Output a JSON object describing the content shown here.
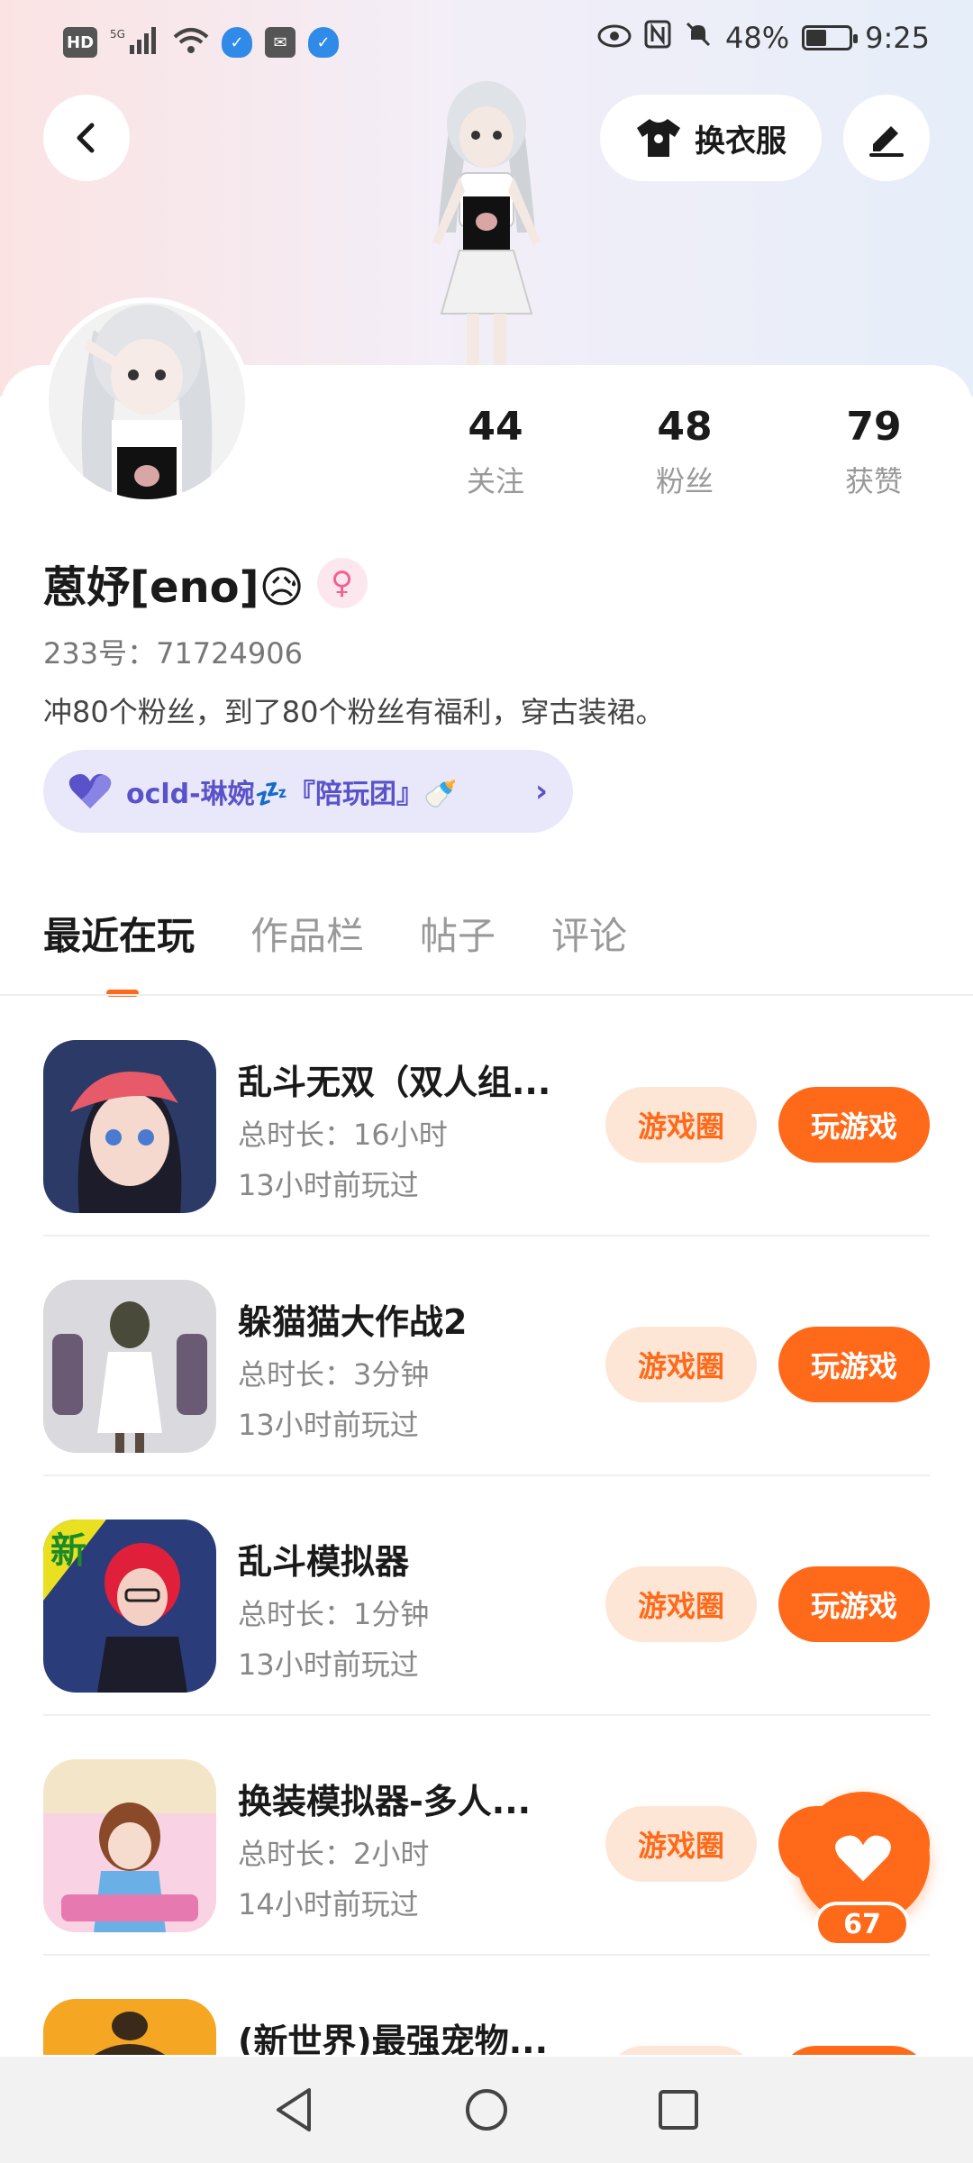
{
  "status_bar": {
    "left_icons": [
      "HD",
      "5G",
      "signal-icon",
      "wifi-icon",
      "shield-icon",
      "mail-icon",
      "shield-icon"
    ],
    "battery_percent": "48%",
    "battery_level": 0.48,
    "time": "9:25"
  },
  "header": {
    "wardrobe_label": "换衣服"
  },
  "profile": {
    "stats": [
      {
        "value": "44",
        "label": "关注"
      },
      {
        "value": "48",
        "label": "粉丝"
      },
      {
        "value": "79",
        "label": "获赞"
      }
    ],
    "name": "蒽妤[eno]😥",
    "gender_symbol": "♀",
    "uid": "233号：71724906",
    "bio": "冲80个粉丝，到了80个粉丝有福利，穿古装裙。",
    "group": {
      "label": "ocld-琳婉💤『陪玩团』🍼"
    }
  },
  "tabs": [
    {
      "label": "最近在玩",
      "active": true
    },
    {
      "label": "作品栏",
      "active": false
    },
    {
      "label": "帖子",
      "active": false
    },
    {
      "label": "评论",
      "active": false
    }
  ],
  "games": [
    {
      "title": "乱斗无双（双人组...",
      "duration": "总时长：16小时",
      "last_played": "13小时前玩过",
      "circle_label": "游戏圈",
      "play_label": "玩游戏",
      "icon_colors": [
        "#2b3a66",
        "#e65a6a"
      ]
    },
    {
      "title": "躲猫猫大作战2",
      "duration": "总时长：3分钟",
      "last_played": "13小时前玩过",
      "circle_label": "游戏圈",
      "play_label": "玩游戏",
      "icon_colors": [
        "#d9d9de",
        "#5a4a60"
      ]
    },
    {
      "title": "乱斗模拟器",
      "duration": "总时长：1分钟",
      "last_played": "13小时前玩过",
      "circle_label": "游戏圈",
      "play_label": "玩游戏",
      "icon_colors": [
        "#2a3c7a",
        "#e0203a"
      ]
    },
    {
      "title": "换装模拟器-多人...",
      "duration": "总时长：2小时",
      "last_played": "14小时前玩过",
      "circle_label": "游戏圈",
      "play_label": "玩游戏",
      "icon_colors": [
        "#f3e6c8",
        "#e67ab0"
      ]
    },
    {
      "title": "(新世界)最强宠物...",
      "duration": "",
      "last_played": "",
      "circle_label": "",
      "play_label": "",
      "icon_colors": [
        "#f5a623",
        "#3a2a1a"
      ]
    }
  ],
  "like_fab": {
    "count": "67"
  },
  "colors": {
    "accent": "#ff6a1a",
    "accent_soft": "#fde6d6",
    "group_pill_bg": "#e8e8fa",
    "group_pill_text": "#5a52c9"
  }
}
